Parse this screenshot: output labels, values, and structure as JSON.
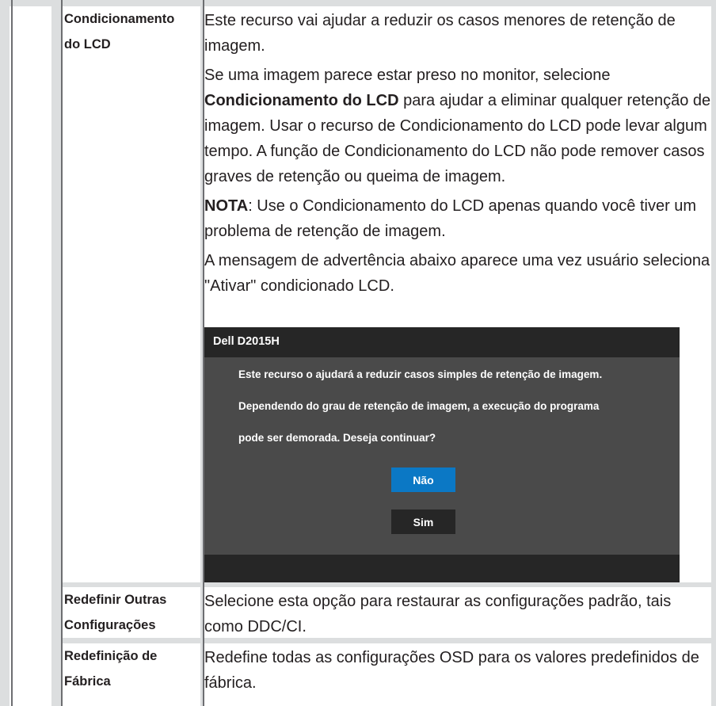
{
  "rows": [
    {
      "label_lines": [
        "Condicionamento",
        "do LCD"
      ],
      "paragraphs": [
        {
          "segments": [
            {
              "text": "Este recurso vai ajudar a reduzir os casos menores de retenção de imagem.",
              "bold": false
            }
          ]
        },
        {
          "segments": [
            {
              "text": "Se uma imagem parece estar preso no monitor, selecione ",
              "bold": false
            },
            {
              "text": "Condicionamento do LCD",
              "bold": true
            },
            {
              "text": " para ajudar a eliminar qualquer retenção de imagem. Usar o recurso de Condicionamento do LCD pode levar algum tempo. A função de Condicionamento do LCD não pode remover casos graves de retenção ou queima de imagem.",
              "bold": false
            }
          ]
        },
        {
          "segments": [
            {
              "text": "NOTA",
              "bold": true
            },
            {
              "text": ": Use o Condicionamento do LCD apenas quando você tiver um problema de retenção de imagem.",
              "bold": false
            }
          ]
        },
        {
          "segments": [
            {
              "text": "A mensagem de advertência abaixo aparece uma vez usuário seleciona \"Ativar\" condicionado LCD.",
              "bold": false
            }
          ]
        }
      ]
    },
    {
      "label_lines": [
        "Redefinir Outras",
        "Configurações"
      ],
      "paragraphs": [
        {
          "segments": [
            {
              "text": "Selecione esta opção para restaurar as configurações padrão, tais como DDC/CI.",
              "bold": false
            }
          ]
        }
      ]
    },
    {
      "label_lines": [
        "Redefinição de",
        "Fábrica"
      ],
      "paragraphs": [
        {
          "segments": [
            {
              "text": "Redefine todas as configurações OSD para os valores predefinidos de fábrica.",
              "bold": false
            }
          ]
        }
      ]
    }
  ],
  "dialog": {
    "title": "Dell D2015H",
    "message_lines": [
      "Este recurso o ajudará a reduzir casos simples de retenção de imagem.",
      "Dependendo do grau de retenção de imagem, a execução do programa",
      "pode ser demorada. Deseja continuar?"
    ],
    "no_label": "Não",
    "yes_label": "Sim"
  },
  "colors": {
    "table_grid": "#dcdedf",
    "table_border": "#6d6e71",
    "dialog_body": "#4a4a4a",
    "dialog_bar": "#262626",
    "dialog_primary_button": "#0b78c5"
  }
}
